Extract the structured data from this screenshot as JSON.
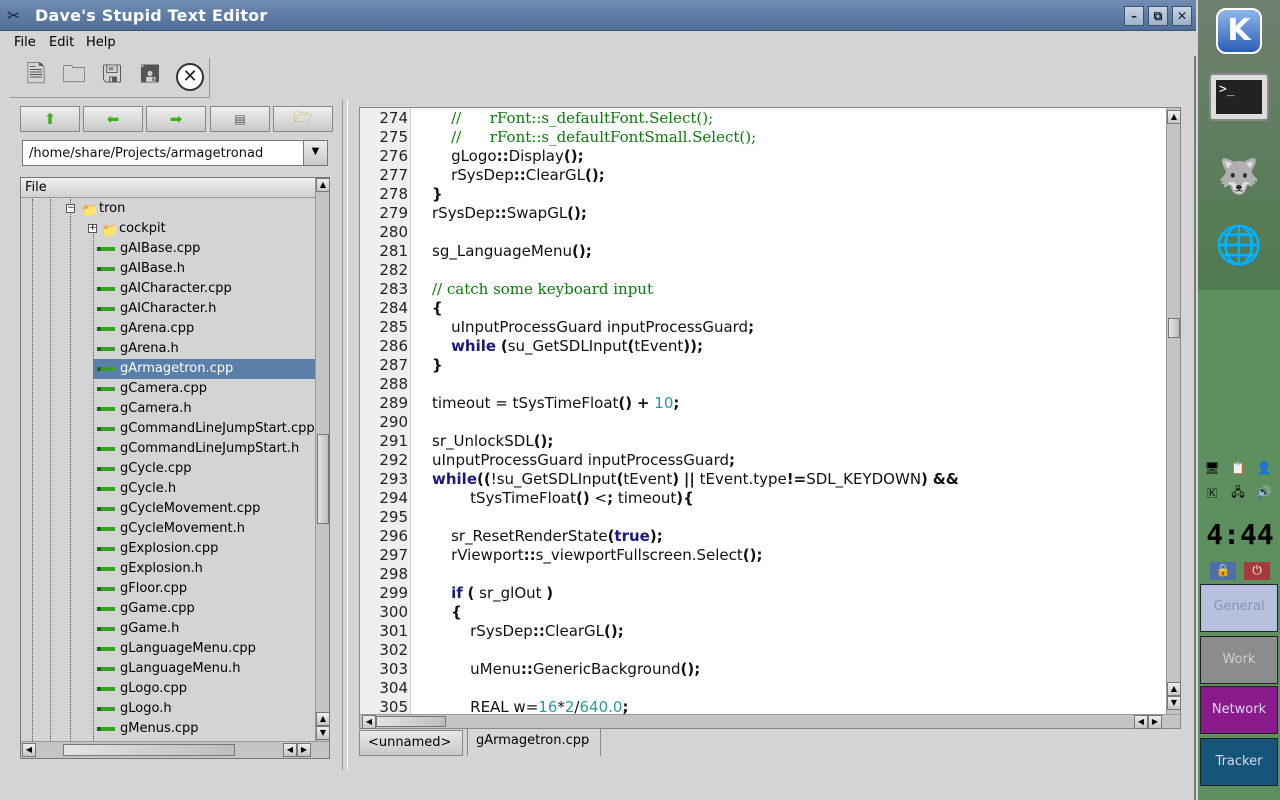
{
  "window": {
    "title": "Dave's Stupid Text Editor",
    "buttons": {
      "minimize": "–",
      "maximize": "⧉",
      "close": "✕"
    }
  },
  "menu": {
    "file": "File",
    "edit": "Edit",
    "help": "Help"
  },
  "toolbar": {
    "icons": [
      "new-file-icon",
      "open-folder-icon",
      "save-icon",
      "save-as-icon",
      "close-file-icon"
    ]
  },
  "nav": {
    "icons": [
      "up-arrow-icon",
      "back-arrow-icon",
      "forward-arrow-icon",
      "view-toggle-icon",
      "new-folder-icon"
    ]
  },
  "path": {
    "value": "/home/share/Projects/armagetronad"
  },
  "tree": {
    "header": "File",
    "folders": [
      {
        "label": "tron",
        "state": "expanded"
      },
      {
        "label": "cockpit",
        "state": "collapsed"
      }
    ],
    "files": [
      "gAIBase.cpp",
      "gAIBase.h",
      "gAICharacter.cpp",
      "gAICharacter.h",
      "gArena.cpp",
      "gArena.h",
      "gArmagetron.cpp",
      "gCamera.cpp",
      "gCamera.h",
      "gCommandLineJumpStart.cpp",
      "gCommandLineJumpStart.h",
      "gCycle.cpp",
      "gCycle.h",
      "gCycleMovement.cpp",
      "gCycleMovement.h",
      "gExplosion.cpp",
      "gExplosion.h",
      "gFloor.cpp",
      "gGame.cpp",
      "gGame.h",
      "gLanguageMenu.cpp",
      "gLanguageMenu.h",
      "gLogo.cpp",
      "gLogo.h",
      "gMenus.cpp"
    ],
    "selected": "gArmagetron.cpp"
  },
  "editor": {
    "lines": [
      {
        "n": "274",
        "t": "    //      rFont::s_defaultFont.Select();"
      },
      {
        "n": "275",
        "t": "    //      rFont::s_defaultFontSmall.Select();"
      },
      {
        "n": "276",
        "t": "    gLogo::Display();"
      },
      {
        "n": "277",
        "t": "    rSysDep::ClearGL();"
      },
      {
        "n": "278",
        "t": "}"
      },
      {
        "n": "279",
        "t": "rSysDep::SwapGL();"
      },
      {
        "n": "280",
        "t": ""
      },
      {
        "n": "281",
        "t": "sg_LanguageMenu();"
      },
      {
        "n": "282",
        "t": ""
      },
      {
        "n": "283",
        "t": "// catch some keyboard input"
      },
      {
        "n": "284",
        "t": "{"
      },
      {
        "n": "285",
        "t": "    uInputProcessGuard inputProcessGuard;"
      },
      {
        "n": "286",
        "t": "    while (su_GetSDLInput(tEvent));"
      },
      {
        "n": "287",
        "t": "}"
      },
      {
        "n": "288",
        "t": ""
      },
      {
        "n": "289",
        "t": "timeout = tSysTimeFloat() + 10;"
      },
      {
        "n": "290",
        "t": ""
      },
      {
        "n": "291",
        "t": "sr_UnlockSDL();"
      },
      {
        "n": "292",
        "t": "uInputProcessGuard inputProcessGuard;"
      },
      {
        "n": "293",
        "t": "while((!su_GetSDLInput(tEvent) || tEvent.type!=SDL_KEYDOWN) &&"
      },
      {
        "n": "294",
        "t": "        tSysTimeFloat() < timeout){"
      },
      {
        "n": "295",
        "t": ""
      },
      {
        "n": "296",
        "t": "    sr_ResetRenderState(true);"
      },
      {
        "n": "297",
        "t": "    rViewport::s_viewportFullscreen.Select();"
      },
      {
        "n": "298",
        "t": ""
      },
      {
        "n": "299",
        "t": "    if ( sr_glOut )"
      },
      {
        "n": "300",
        "t": "    {"
      },
      {
        "n": "301",
        "t": "        rSysDep::ClearGL();"
      },
      {
        "n": "302",
        "t": ""
      },
      {
        "n": "303",
        "t": "        uMenu::GenericBackground();"
      },
      {
        "n": "304",
        "t": ""
      },
      {
        "n": "305",
        "t": "        REAL w=16*2/640.0;"
      }
    ]
  },
  "tabs": [
    {
      "label": "<unnamed>",
      "active": false
    },
    {
      "label": "gArmagetron.cpp",
      "active": true
    }
  ],
  "panel": {
    "clock": "4:44",
    "desktops": [
      "General",
      "Work",
      "Network",
      "Tracker"
    ],
    "launchers": [
      "kde-menu-icon",
      "terminal-icon",
      "gimp-icon",
      "konqueror-browser-icon"
    ],
    "colors": {
      "general": "#1b2fa0",
      "work": "#7a7a7a",
      "network": "#8a1a8a",
      "tracker": "#15557a"
    }
  }
}
